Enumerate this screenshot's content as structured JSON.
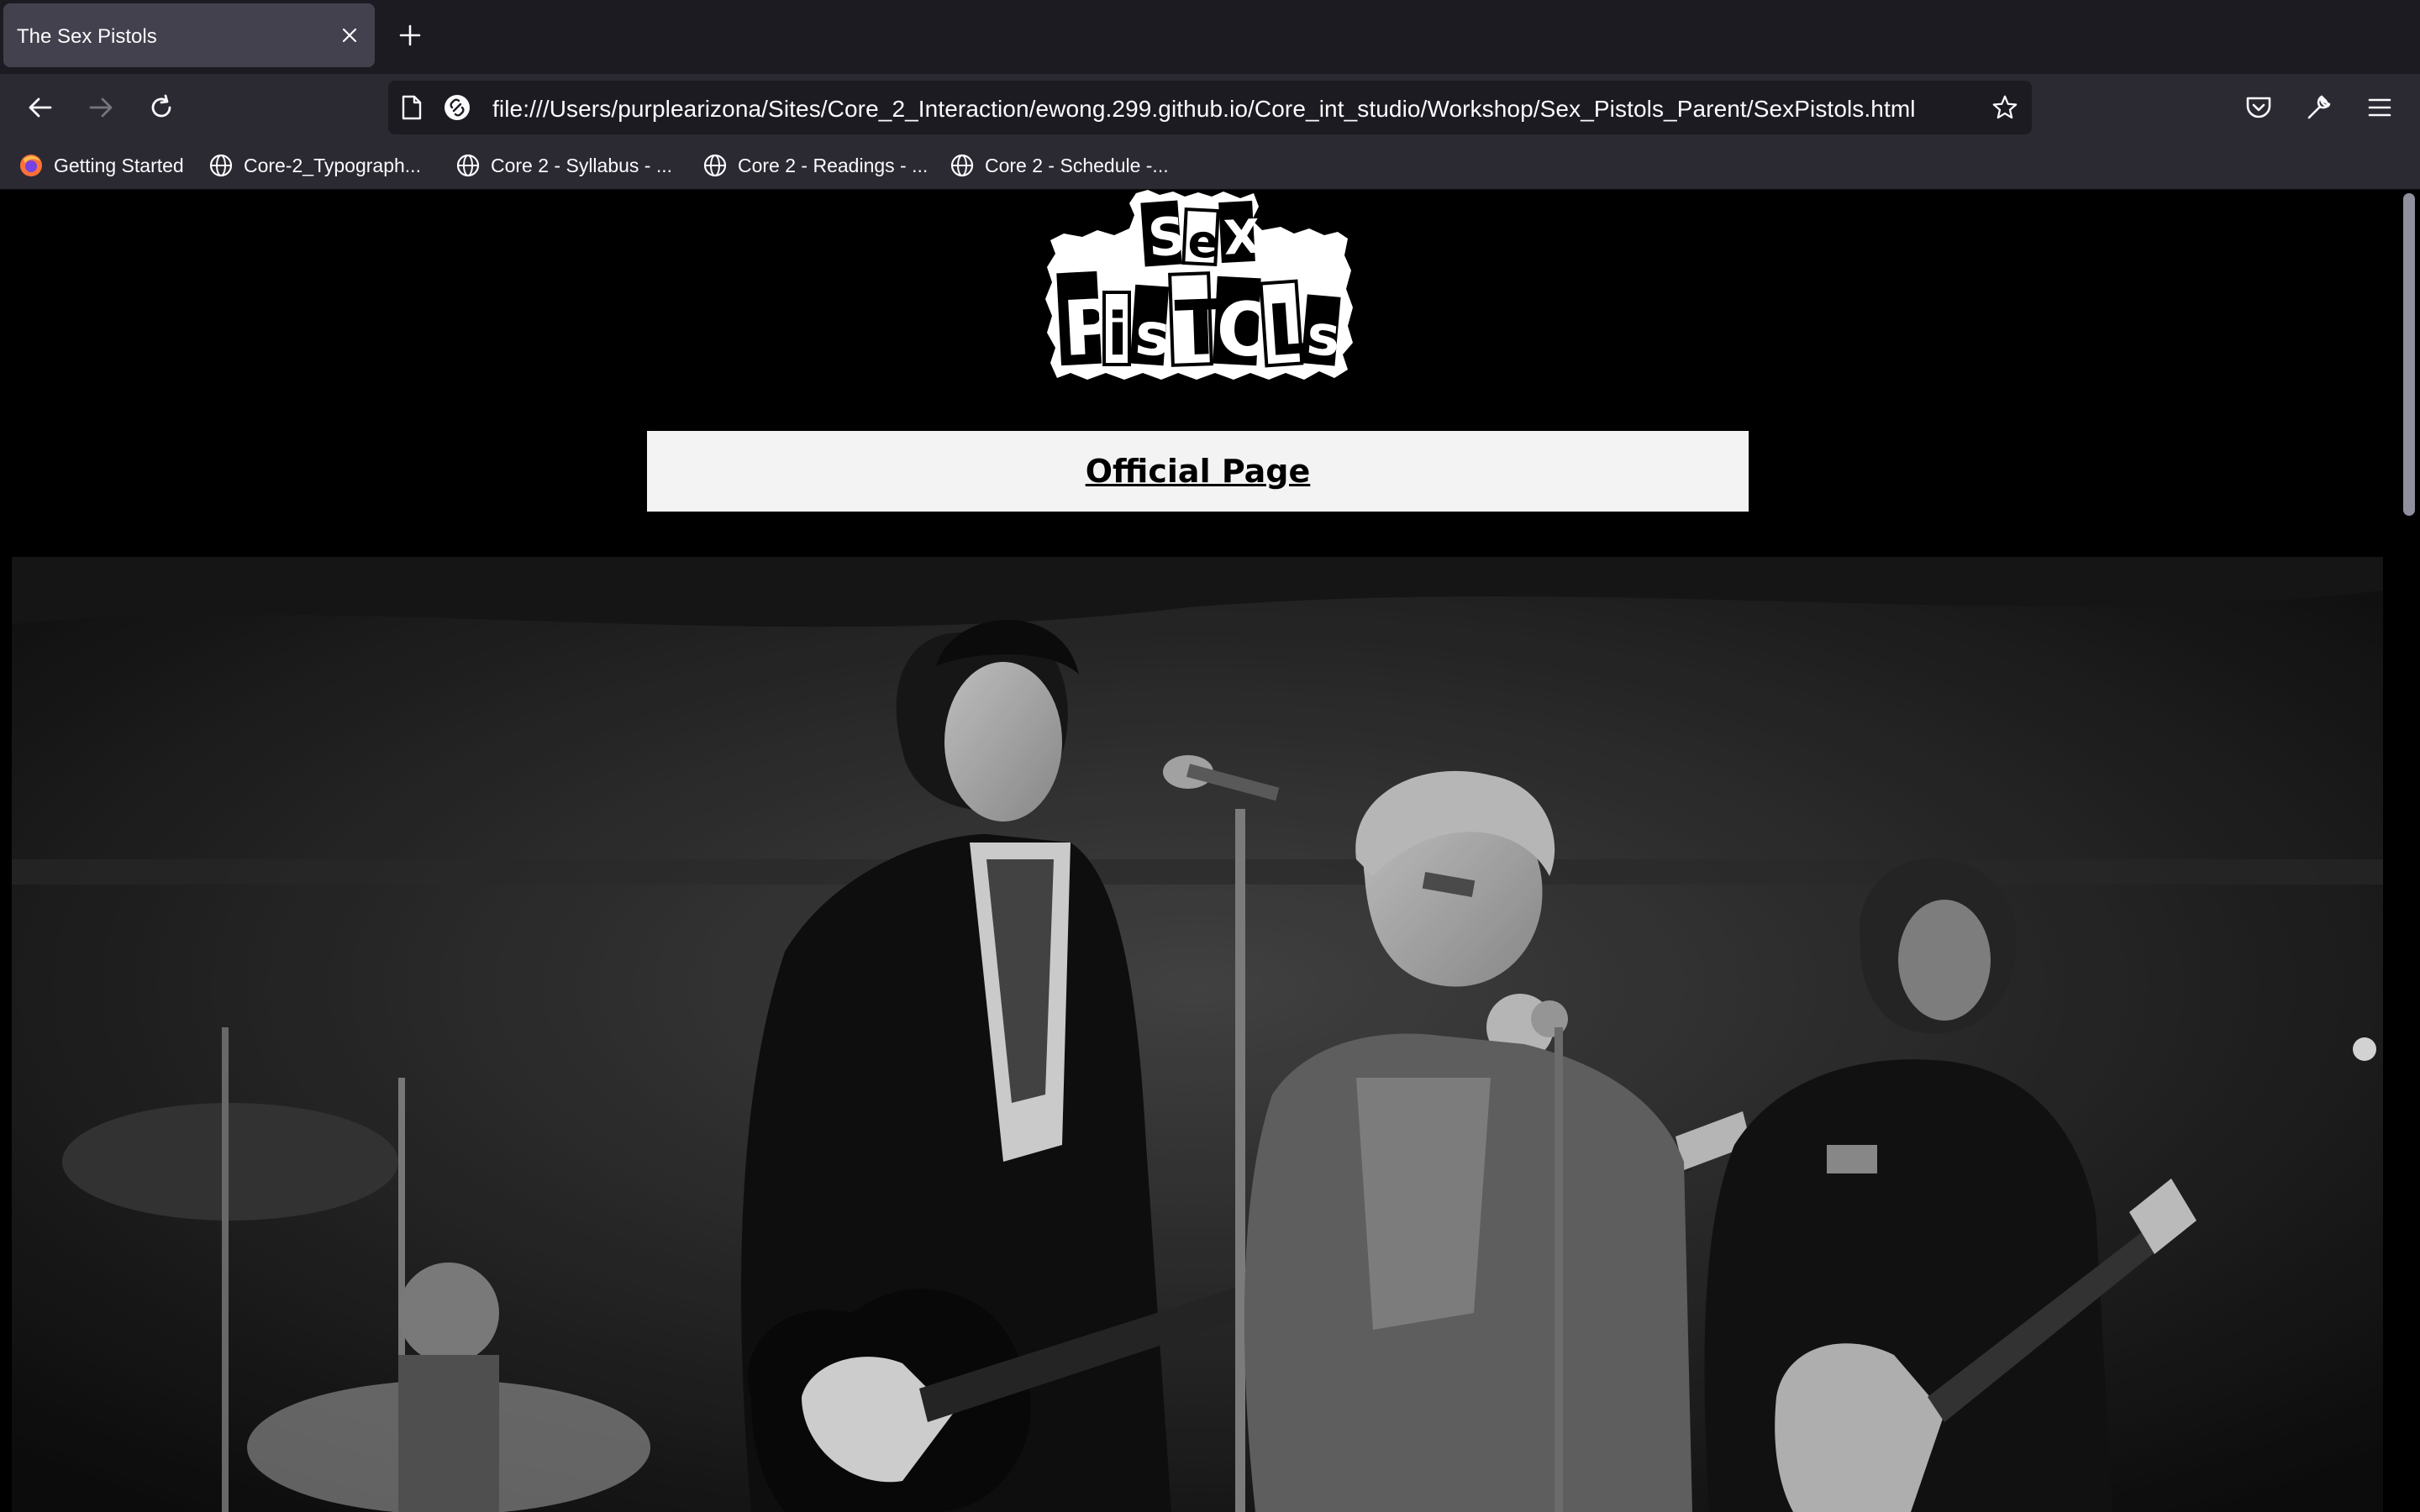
{
  "browser": {
    "tab": {
      "title": "The Sex Pistols"
    },
    "url": "file:///Users/purplearizona/Sites/Core_2_Interaction/ewong.299.github.io/Core_int_studio/Workshop/Sex_Pistols_Parent/SexPistols.html",
    "bookmarks": [
      {
        "label": "Getting Started",
        "icon": "firefox-icon"
      },
      {
        "label": "Core-2_Typograph...",
        "icon": "globe-icon"
      },
      {
        "label": "Core 2 - Syllabus - ...",
        "icon": "globe-icon"
      },
      {
        "label": "Core 2 - Readings - ...",
        "icon": "globe-icon"
      },
      {
        "label": "Core 2 - Schedule -...",
        "icon": "globe-icon"
      }
    ]
  },
  "page": {
    "logo_text": "SEX PISTOLS",
    "official_link": "Official Page",
    "hero_image": "black-and-white photo of the band performing on stage"
  },
  "colors": {
    "page_background": "#000000",
    "link_box_background": "#f3f3f3",
    "browser_chrome": "#2b2a33",
    "tab_strip": "#1c1b22"
  }
}
